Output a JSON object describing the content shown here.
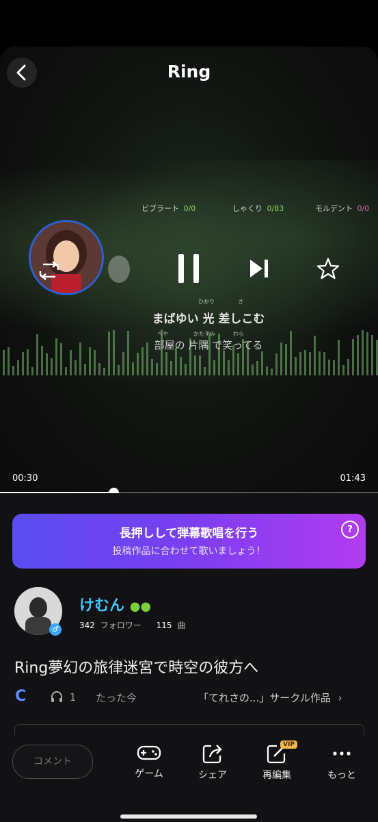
{
  "header": {
    "title": "Ring"
  },
  "player": {
    "scores": [
      {
        "label": "ビブラート",
        "value": "0/0"
      },
      {
        "label": "しゃくり",
        "value": "0/83"
      },
      {
        "label": "モルデント",
        "value": "0/0"
      }
    ],
    "lyrics": {
      "line1": "まばゆい 光 差しこむ",
      "line1_ruby": [
        "ひかり",
        "さ"
      ],
      "line2": "部屋の 片隅 で笑ってる",
      "line2_ruby": [
        "へや",
        "かたすみ",
        "わら"
      ]
    },
    "time_current": "00:30",
    "time_total": "01:43",
    "progress": 0.3
  },
  "banner": {
    "title": "長押しして弾幕歌唱を行う",
    "subtitle": "投稿作品に合わせて歌いましょう！",
    "help_icon": "?"
  },
  "user": {
    "name": "けむん",
    "followers_count": "342",
    "followers_label": "フォロワー",
    "songs_count": "115",
    "songs_label": "曲"
  },
  "post": {
    "title": "Ring夢幻の旅律迷宮で時空の彼方へ",
    "listen_count": "1",
    "time_ago": "たった今",
    "circle_label": "「てれさの...」サークル作品"
  },
  "bottom_bar": {
    "comment_placeholder": "コメント",
    "actions": [
      {
        "label": "ゲーム",
        "icon": "gamepad-icon"
      },
      {
        "label": "シェア",
        "icon": "share-icon"
      },
      {
        "label": "再編集",
        "icon": "edit-icon",
        "badge": "VIP"
      },
      {
        "label": "もっと",
        "icon": "more-icon"
      }
    ]
  },
  "colors": {
    "accent_blue": "#3fc4ff",
    "banner_start": "#5a4cf2",
    "banner_end": "#b23cf0",
    "vip_badge": "#f2b84b"
  }
}
